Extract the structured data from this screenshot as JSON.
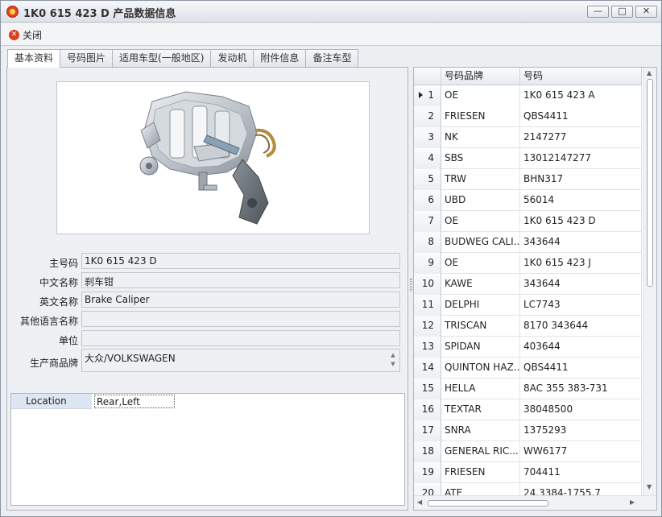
{
  "window": {
    "title": "1K0 615 423 D 产品数据信息"
  },
  "toolbar": {
    "close_label": "关闭"
  },
  "tabs": [
    "基本资料",
    "号码图片",
    "适用车型(一般地区)",
    "发动机",
    "附件信息",
    "备注车型"
  ],
  "form": {
    "main_code_label": "主号码",
    "main_code_value": "1K0 615 423 D",
    "cn_name_label": "中文名称",
    "cn_name_value": "刹车钳",
    "en_name_label": "英文名称",
    "en_name_value": "Brake Caliper",
    "other_lang_label": "其他语言名称",
    "other_lang_value": "",
    "unit_label": "单位",
    "unit_value": "",
    "brand_label": "生产商品牌",
    "brand_value": "大众/VOLKSWAGEN"
  },
  "properties": [
    {
      "name": "Location",
      "value": "Rear,Left"
    }
  ],
  "grid": {
    "headers": {
      "brand": "号码品牌",
      "code": "号码"
    },
    "rows": [
      {
        "idx": "1",
        "brand": "OE",
        "code": "1K0 615 423 A"
      },
      {
        "idx": "2",
        "brand": "FRIESEN",
        "code": "QBS4411"
      },
      {
        "idx": "3",
        "brand": "NK",
        "code": "2147277"
      },
      {
        "idx": "4",
        "brand": "SBS",
        "code": "13012147277"
      },
      {
        "idx": "5",
        "brand": "TRW",
        "code": "BHN317"
      },
      {
        "idx": "6",
        "brand": "UBD",
        "code": "56014"
      },
      {
        "idx": "7",
        "brand": "OE",
        "code": "1K0 615 423 D"
      },
      {
        "idx": "8",
        "brand": "BUDWEG CALI...",
        "code": "343644"
      },
      {
        "idx": "9",
        "brand": "OE",
        "code": "1K0 615 423 J"
      },
      {
        "idx": "10",
        "brand": "KAWE",
        "code": "343644"
      },
      {
        "idx": "11",
        "brand": "DELPHI",
        "code": "LC7743"
      },
      {
        "idx": "12",
        "brand": "TRISCAN",
        "code": "8170 343644"
      },
      {
        "idx": "13",
        "brand": "SPIDAN",
        "code": "403644"
      },
      {
        "idx": "14",
        "brand": "QUINTON HAZ...",
        "code": "QBS4411"
      },
      {
        "idx": "15",
        "brand": "HELLA",
        "code": "8AC 355 383-731"
      },
      {
        "idx": "16",
        "brand": "TEXTAR",
        "code": "38048500"
      },
      {
        "idx": "17",
        "brand": "SNRA",
        "code": "1375293"
      },
      {
        "idx": "18",
        "brand": "GENERAL RIC...",
        "code": "WW6177"
      },
      {
        "idx": "19",
        "brand": "FRIESEN",
        "code": "704411"
      },
      {
        "idx": "20",
        "brand": "ATE",
        "code": "24.3384-1755.7"
      }
    ]
  }
}
